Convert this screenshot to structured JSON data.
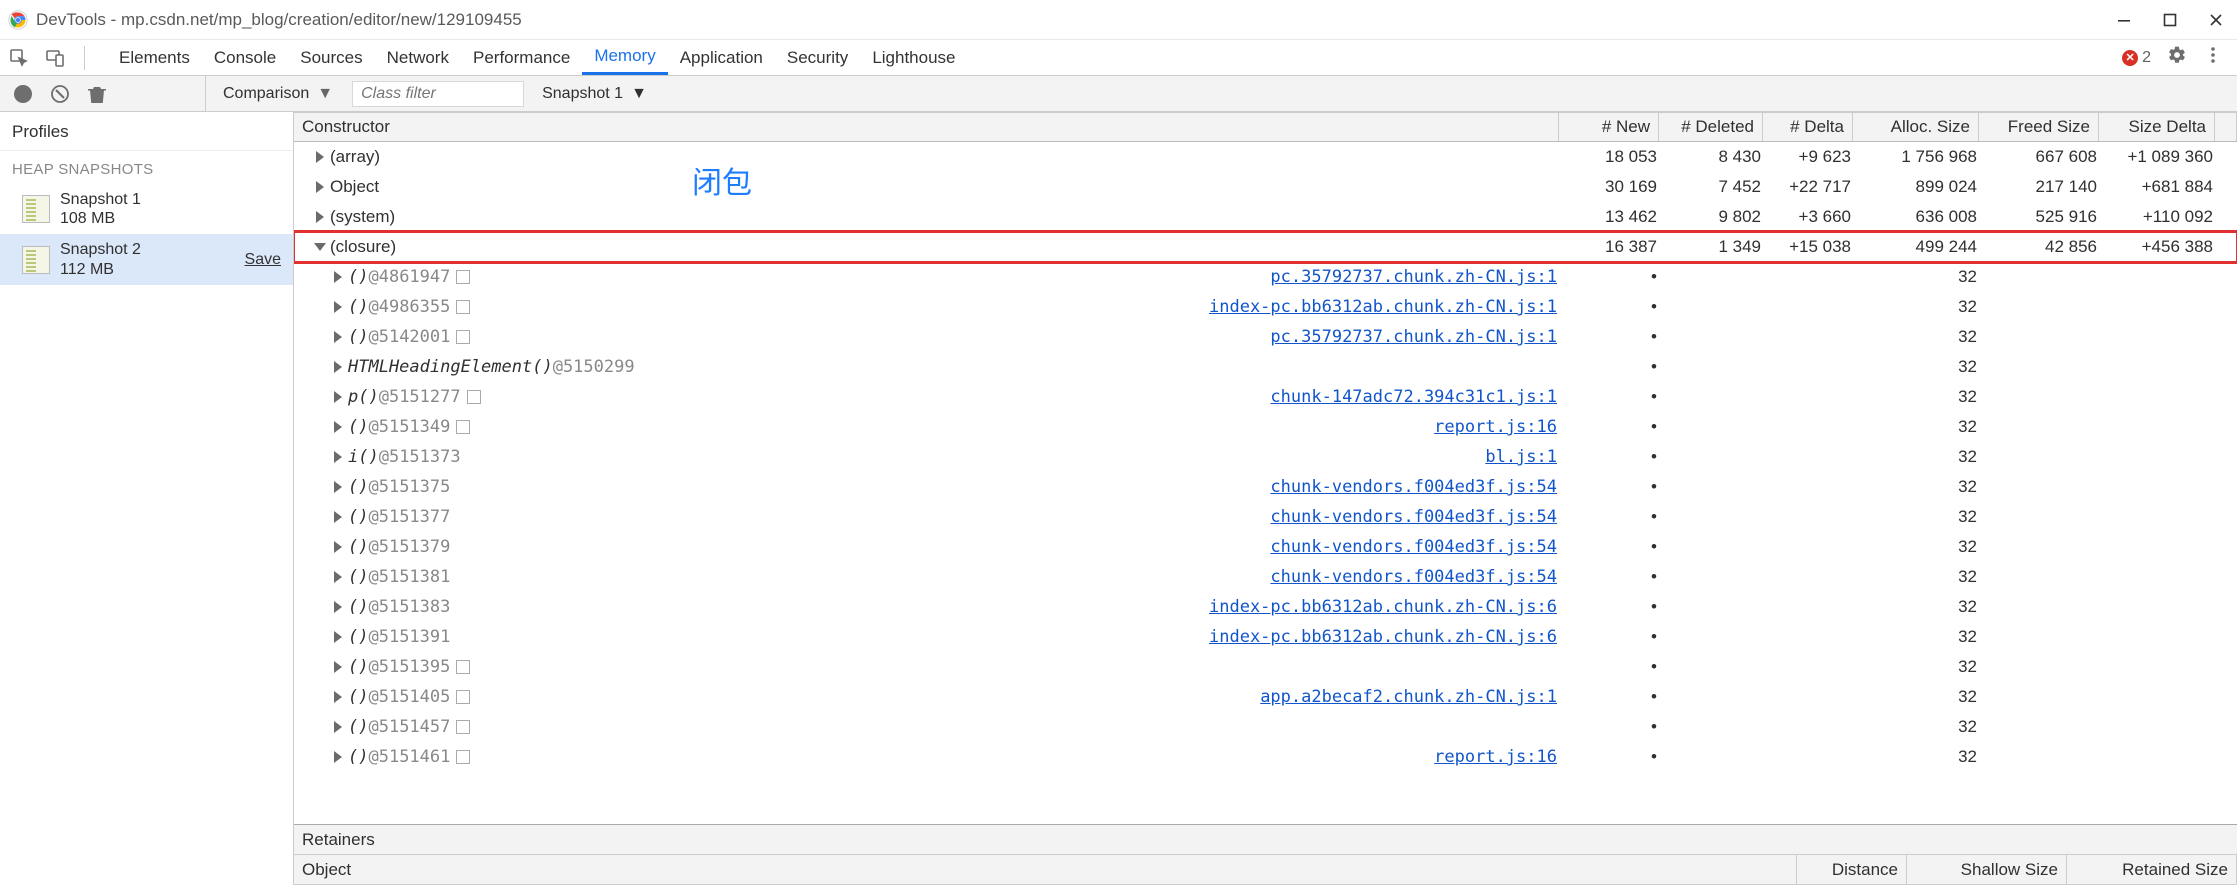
{
  "window": {
    "title": "DevTools - mp.csdn.net/mp_blog/creation/editor/new/129109455"
  },
  "toolbar": {
    "tabs": [
      "Elements",
      "Console",
      "Sources",
      "Network",
      "Performance",
      "Memory",
      "Application",
      "Security",
      "Lighthouse"
    ],
    "activeTabIndex": 5,
    "errorCount": "2"
  },
  "secondbar": {
    "viewMode": "Comparison",
    "classFilterPlaceholder": "Class filter",
    "baseSnapshot": "Snapshot 1"
  },
  "sidebar": {
    "profiles": "Profiles",
    "heapSnapshots": "HEAP SNAPSHOTS",
    "snapshots": [
      {
        "name": "Snapshot 1",
        "size": "108 MB",
        "save": ""
      },
      {
        "name": "Snapshot 2",
        "size": "112 MB",
        "save": "Save"
      }
    ],
    "selectedIndex": 1
  },
  "grid": {
    "headers": [
      "Constructor",
      "# New",
      "# Deleted",
      "# Delta",
      "Alloc. Size",
      "Freed Size",
      "Size Delta"
    ],
    "topRows": [
      {
        "name": "(array)",
        "new": "18 053",
        "del": "8 430",
        "delta": "+9 623",
        "as": "1 756 968",
        "fs": "667 608",
        "sd": "+1 089 360",
        "expanded": false
      },
      {
        "name": "Object",
        "new": "30 169",
        "del": "7 452",
        "delta": "+22 717",
        "as": "899 024",
        "fs": "217 140",
        "sd": "+681 884",
        "expanded": false
      },
      {
        "name": "(system)",
        "new": "13 462",
        "del": "9 802",
        "delta": "+3 660",
        "as": "636 008",
        "fs": "525 916",
        "sd": "+110 092",
        "expanded": false
      },
      {
        "name": "(closure)",
        "new": "16 387",
        "del": "1 349",
        "delta": "+15 038",
        "as": "499 244",
        "fs": "42 856",
        "sd": "+456 388",
        "expanded": true,
        "highlight": true
      }
    ],
    "closureRows": [
      {
        "fn": "()",
        "id": "@4861947",
        "sq": true,
        "src": "pc.35792737.chunk.zh-CN.js:1",
        "as": "32"
      },
      {
        "fn": "()",
        "id": "@4986355",
        "sq": true,
        "src": "index-pc.bb6312ab.chunk.zh-CN.js:1",
        "as": "32"
      },
      {
        "fn": "()",
        "id": "@5142001",
        "sq": true,
        "src": "pc.35792737.chunk.zh-CN.js:1",
        "as": "32"
      },
      {
        "fn": "HTMLHeadingElement()",
        "id": "@5150299",
        "sq": false,
        "src": "",
        "as": "32"
      },
      {
        "fn": "p()",
        "id": "@5151277",
        "sq": true,
        "src": "chunk-147adc72.394c31c1.js:1",
        "as": "32"
      },
      {
        "fn": "()",
        "id": "@5151349",
        "sq": true,
        "src": "report.js:16",
        "as": "32"
      },
      {
        "fn": "i()",
        "id": "@5151373",
        "sq": false,
        "src": "bl.js:1",
        "as": "32"
      },
      {
        "fn": "()",
        "id": "@5151375",
        "sq": false,
        "src": "chunk-vendors.f004ed3f.js:54",
        "as": "32"
      },
      {
        "fn": "()",
        "id": "@5151377",
        "sq": false,
        "src": "chunk-vendors.f004ed3f.js:54",
        "as": "32"
      },
      {
        "fn": "()",
        "id": "@5151379",
        "sq": false,
        "src": "chunk-vendors.f004ed3f.js:54",
        "as": "32"
      },
      {
        "fn": "()",
        "id": "@5151381",
        "sq": false,
        "src": "chunk-vendors.f004ed3f.js:54",
        "as": "32"
      },
      {
        "fn": "()",
        "id": "@5151383",
        "sq": false,
        "src": "index-pc.bb6312ab.chunk.zh-CN.js:6",
        "as": "32"
      },
      {
        "fn": "()",
        "id": "@5151391",
        "sq": false,
        "src": "index-pc.bb6312ab.chunk.zh-CN.js:6",
        "as": "32"
      },
      {
        "fn": "()",
        "id": "@5151395",
        "sq": true,
        "src": "",
        "as": "32"
      },
      {
        "fn": "()",
        "id": "@5151405",
        "sq": true,
        "src": "app.a2becaf2.chunk.zh-CN.js:1",
        "as": "32"
      },
      {
        "fn": "()",
        "id": "@5151457",
        "sq": true,
        "src": "",
        "as": "32"
      },
      {
        "fn": "()",
        "id": "@5151461",
        "sq": true,
        "src": "report.js:16",
        "as": "32"
      }
    ],
    "annotation": "闭包"
  },
  "retainers": {
    "title": "Retainers",
    "cols": [
      "Object",
      "Distance",
      "Shallow Size",
      "Retained Size"
    ]
  }
}
